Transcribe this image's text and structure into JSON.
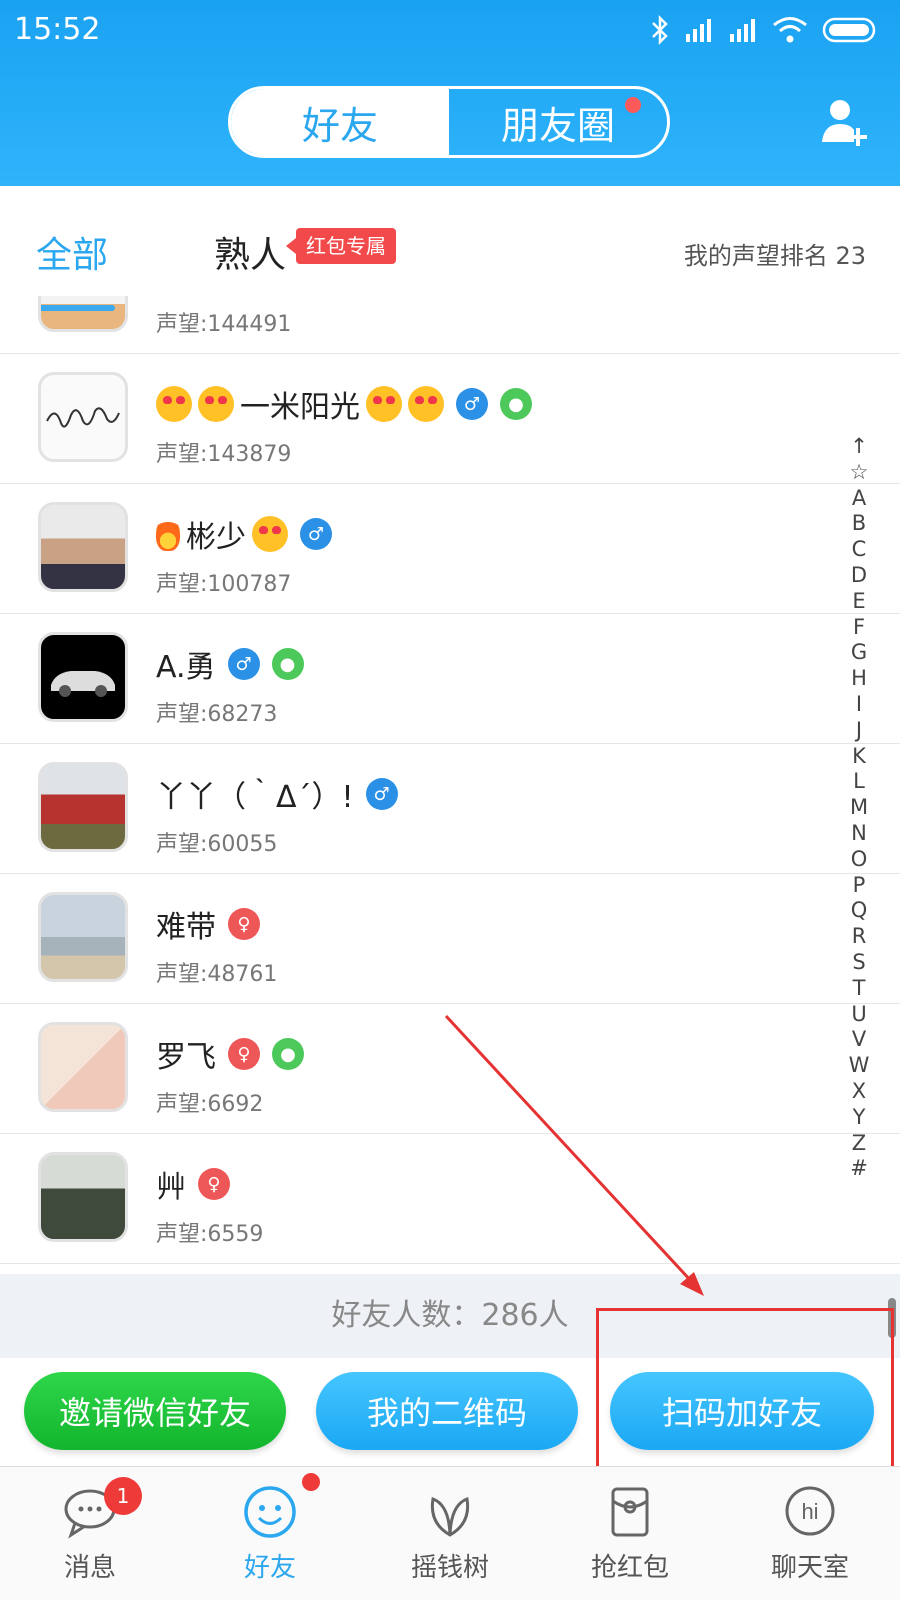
{
  "status": {
    "time": "15:52"
  },
  "header": {
    "tabs": [
      {
        "label": "好友",
        "active": true
      },
      {
        "label": "朋友圈",
        "has_dot": true
      }
    ]
  },
  "filter": {
    "all": "全部",
    "acquaintance": "熟人",
    "badge": "红包专属",
    "rank_text": "我的声望排名 23"
  },
  "contacts": [
    {
      "name": "",
      "score": "声望:144491"
    },
    {
      "name": "一米阳光",
      "score": "声望:143879",
      "tags": [
        "male",
        "wechat"
      ]
    },
    {
      "name": "彬少",
      "score": "声望:100787",
      "tags": [
        "male"
      ]
    },
    {
      "name": "A.勇",
      "score": "声望:68273",
      "tags": [
        "male",
        "wechat"
      ]
    },
    {
      "name": "丫丫（｀Δ´）!",
      "score": "声望:60055",
      "tags": [
        "male"
      ]
    },
    {
      "name": "难带",
      "score": "声望:48761",
      "tags": [
        "female"
      ]
    },
    {
      "name": "罗飞",
      "score": "声望:6692",
      "tags": [
        "female",
        "wechat"
      ]
    },
    {
      "name": "艸",
      "score": "声望:6559",
      "tags": [
        "female"
      ]
    }
  ],
  "index_letters": [
    "↑",
    "☆",
    "A",
    "B",
    "C",
    "D",
    "E",
    "F",
    "G",
    "H",
    "I",
    "J",
    "K",
    "L",
    "M",
    "N",
    "O",
    "P",
    "Q",
    "R",
    "S",
    "T",
    "U",
    "V",
    "W",
    "X",
    "Y",
    "Z",
    "#"
  ],
  "friend_count": "好友人数：286人",
  "actions": {
    "invite": "邀请微信好友",
    "qrcode": "我的二维码",
    "scan": "扫码加好友"
  },
  "nav": [
    {
      "label": "消息",
      "badge": "1"
    },
    {
      "label": "好友",
      "active": true
    },
    {
      "label": "摇钱树"
    },
    {
      "label": "抢红包"
    },
    {
      "label": "聊天室"
    }
  ],
  "colors": {
    "brand": "#2aa7ef",
    "green": "#12b52d",
    "red": "#e53232"
  }
}
